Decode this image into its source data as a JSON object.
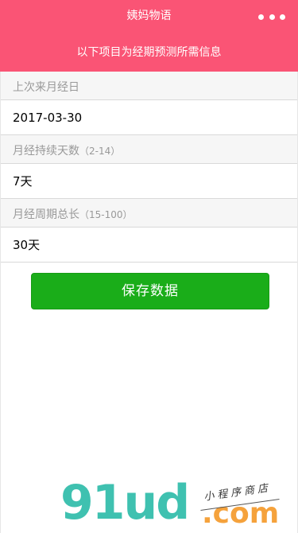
{
  "nav": {
    "title": "姨妈物语",
    "more_icon": "more-dots-icon"
  },
  "header": {
    "subtitle": "以下项目为经期预测所需信息"
  },
  "form": {
    "last_period": {
      "label": "上次来月经日",
      "value": "2017-03-30"
    },
    "duration": {
      "label": "月经持续天数",
      "hint": "（2-14）",
      "value": "7天"
    },
    "cycle": {
      "label": "月经周期总长",
      "hint": "（15-100）",
      "value": "30天"
    }
  },
  "save_button": {
    "label": "保存数据"
  },
  "watermark": {
    "main": "91ud",
    "domain": ".com",
    "tagline": "小程序商店"
  },
  "colors": {
    "header_bg": "#fa5475",
    "button_bg": "#1aad19",
    "watermark_teal": "#3fc1b0",
    "watermark_orange": "#f5a23c"
  }
}
